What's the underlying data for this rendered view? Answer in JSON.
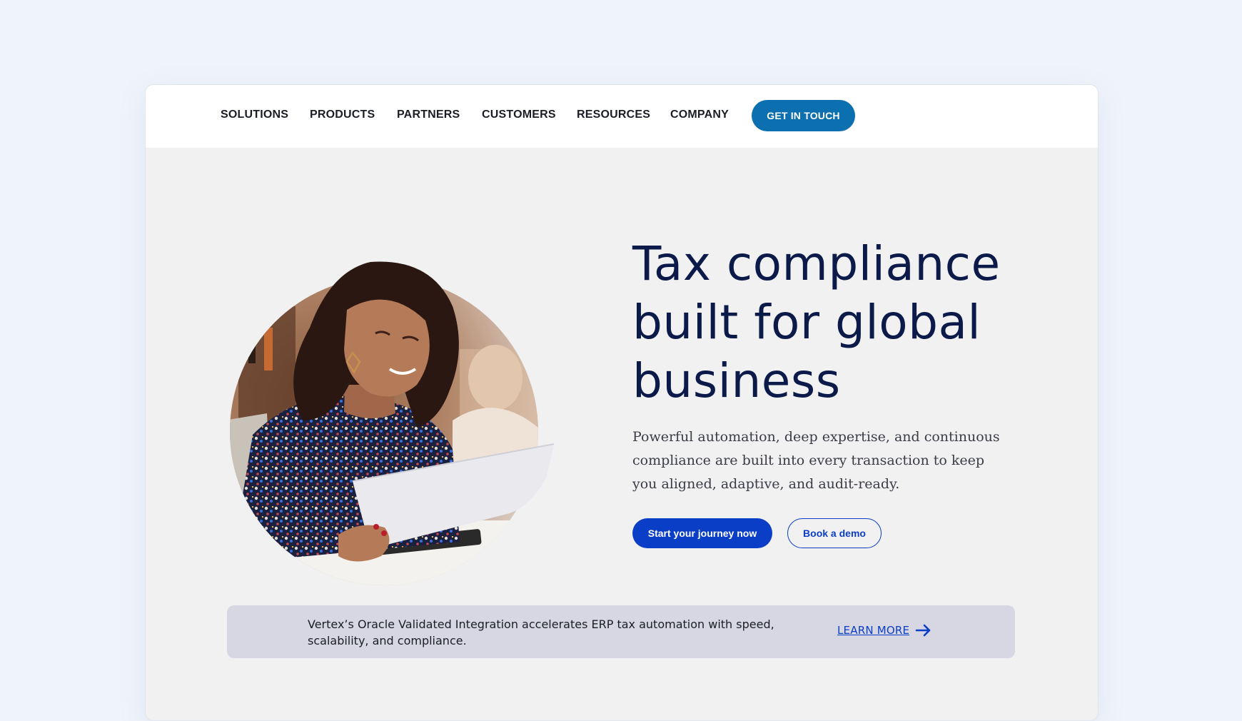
{
  "nav": {
    "items": [
      {
        "label": "SOLUTIONS"
      },
      {
        "label": "PRODUCTS"
      },
      {
        "label": "PARTNERS"
      },
      {
        "label": "CUSTOMERS"
      },
      {
        "label": "RESOURCES"
      },
      {
        "label": "COMPANY"
      }
    ],
    "cta_label": "GET IN TOUCH"
  },
  "hero": {
    "title_lines": [
      "Tax compliance",
      "built for global",
      "business"
    ],
    "subtitle": "Powerful automation, deep expertise, and continuous compliance are built into every transaction to keep you aligned, adaptive, and audit-ready.",
    "primary_button": "Start your journey now",
    "secondary_button": "Book a demo"
  },
  "banner": {
    "text": "Vertex’s Oracle Validated Integration accelerates ERP tax automation with speed, scalability, and compliance.",
    "link_label": "LEARN MORE",
    "link_icon": "arrow-right-icon"
  },
  "colors": {
    "page_background": "#eff4fb",
    "nav_cta": "#0b6fb0",
    "heading": "#0c1a4a",
    "primary_button": "#0b3ec7",
    "banner_background": "#d6d7e3"
  }
}
